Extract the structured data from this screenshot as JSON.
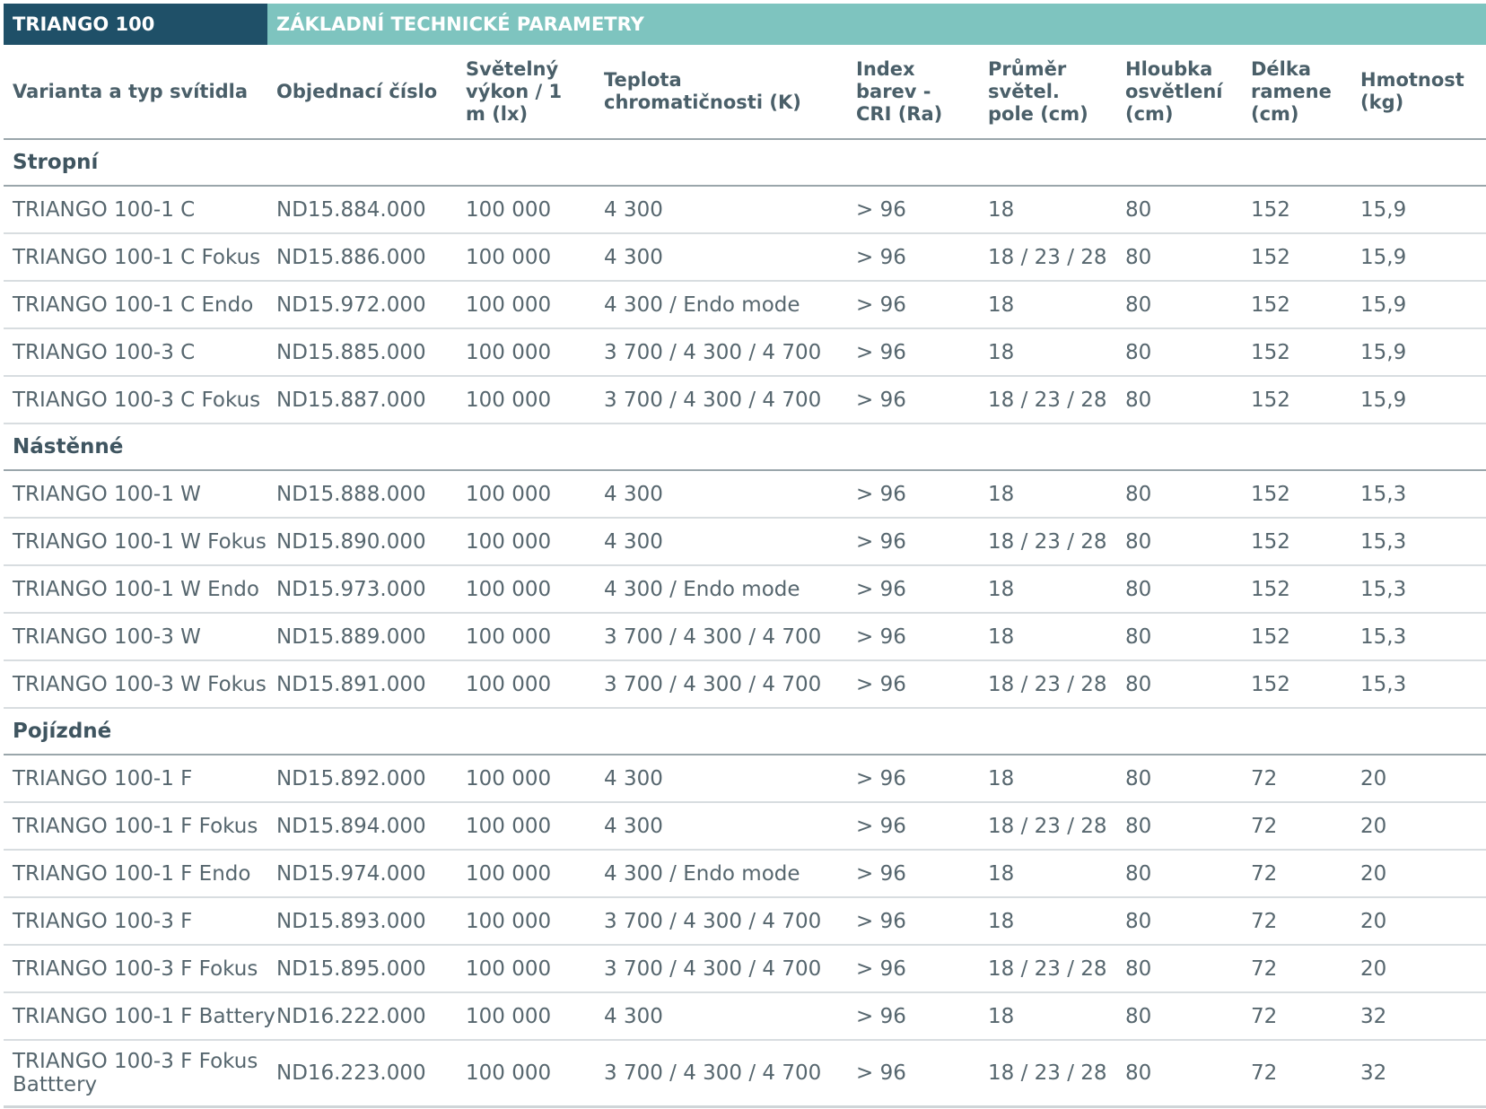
{
  "title": {
    "product": "TRIANGO 100",
    "section": "ZÁKLADNÍ TECHNICKÉ PARAMETRY"
  },
  "headers": [
    "Varianta a typ svítidla",
    "Objednací číslo",
    "Světelný výkon / 1 m (lx)",
    "Teplota chromatičnosti (K)",
    "Index barev - CRI (Ra)",
    "Průměr světel. pole (cm)",
    "Hloubka osvětlení (cm)",
    "Délka ramene (cm)",
    "Hmotnost (kg)"
  ],
  "groups": [
    {
      "name": "Stropní",
      "rows": [
        [
          "TRIANGO 100-1 C",
          "ND15.884.000",
          "100 000",
          "4 300",
          "> 96",
          "18",
          "80",
          "152",
          "15,9"
        ],
        [
          "TRIANGO 100-1 C Fokus",
          "ND15.886.000",
          "100 000",
          "4 300",
          "> 96",
          "18 / 23 / 28",
          "80",
          "152",
          "15,9"
        ],
        [
          "TRIANGO 100-1 C Endo",
          "ND15.972.000",
          "100 000",
          "4 300 / Endo mode",
          "> 96",
          "18",
          "80",
          "152",
          "15,9"
        ],
        [
          "TRIANGO 100-3 C",
          "ND15.885.000",
          "100 000",
          "3 700 / 4 300 / 4 700",
          "> 96",
          "18",
          "80",
          "152",
          "15,9"
        ],
        [
          "TRIANGO 100-3 C Fokus",
          "ND15.887.000",
          "100 000",
          "3 700 / 4 300 / 4 700",
          "> 96",
          "18 / 23 / 28",
          "80",
          "152",
          "15,9"
        ]
      ]
    },
    {
      "name": "Nástěnné",
      "rows": [
        [
          "TRIANGO 100-1 W",
          "ND15.888.000",
          "100 000",
          "4 300",
          "> 96",
          "18",
          "80",
          "152",
          "15,3"
        ],
        [
          "TRIANGO 100-1 W Fokus",
          "ND15.890.000",
          "100 000",
          "4 300",
          "> 96",
          "18 / 23 / 28",
          "80",
          "152",
          "15,3"
        ],
        [
          "TRIANGO 100-1 W Endo",
          "ND15.973.000",
          "100 000",
          "4 300 / Endo mode",
          "> 96",
          "18",
          "80",
          "152",
          "15,3"
        ],
        [
          "TRIANGO 100-3 W",
          "ND15.889.000",
          "100 000",
          "3 700 / 4 300 / 4 700",
          "> 96",
          "18",
          "80",
          "152",
          "15,3"
        ],
        [
          "TRIANGO 100-3 W Fokus",
          "ND15.891.000",
          "100 000",
          "3 700 / 4 300 / 4 700",
          "> 96",
          "18 / 23 / 28",
          "80",
          "152",
          "15,3"
        ]
      ]
    },
    {
      "name": "Pojízdné",
      "rows": [
        [
          "TRIANGO 100-1  F",
          "ND15.892.000",
          "100 000",
          "4 300",
          "> 96",
          "18",
          "80",
          "72",
          "20"
        ],
        [
          "TRIANGO 100-1  F Fokus",
          "ND15.894.000",
          "100 000",
          "4 300",
          "> 96",
          "18 / 23 / 28",
          "80",
          "72",
          "20"
        ],
        [
          "TRIANGO 100-1  F Endo",
          "ND15.974.000",
          "100 000",
          "4 300 / Endo mode",
          "> 96",
          "18",
          "80",
          "72",
          "20"
        ],
        [
          "TRIANGO 100-3  F",
          "ND15.893.000",
          "100 000",
          "3 700 / 4 300 / 4 700",
          "> 96",
          "18",
          "80",
          "72",
          "20"
        ],
        [
          "TRIANGO 100-3  F Fokus",
          "ND15.895.000",
          "100 000",
          "3 700 / 4 300 / 4 700",
          "> 96",
          "18 / 23 / 28",
          "80",
          "72",
          "20"
        ],
        [
          "TRIANGO 100-1  F Battery",
          "ND16.222.000",
          "100 000",
          "4 300",
          "> 96",
          "18",
          "80",
          "72",
          "32"
        ],
        [
          "TRIANGO 100-3  F Fokus Batttery",
          "ND16.223.000",
          "100 000",
          "3 700 / 4 300 / 4 700",
          "> 96",
          "18 / 23 / 28",
          "80",
          "72",
          "32"
        ]
      ]
    }
  ]
}
